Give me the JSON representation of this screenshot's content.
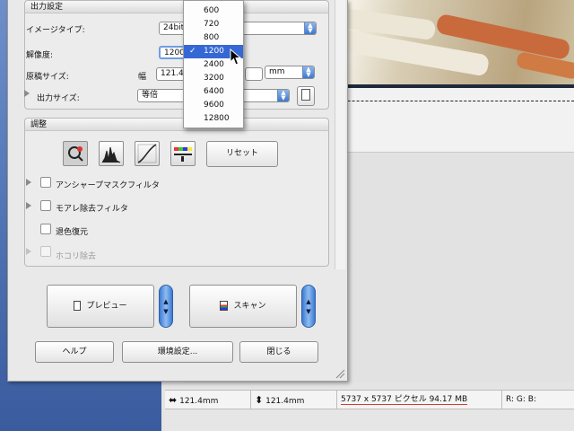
{
  "output_settings": {
    "title": "出力設定",
    "image_type_label": "イメージタイプ:",
    "image_type_value": "24bit",
    "resolution_label": "解像度:",
    "resolution_value": "1200",
    "size_label": "原稿サイズ:",
    "width_label": "幅",
    "width_value": "121.4",
    "unit_value": "mm",
    "output_size_label": "出力サイズ:",
    "output_size_value": "等倍"
  },
  "resolution_dropdown": {
    "options": [
      "600",
      "720",
      "800",
      "1200",
      "2400",
      "3200",
      "6400",
      "9600",
      "12800"
    ],
    "selected": "1200",
    "check_mark": "✓"
  },
  "adjust": {
    "title": "調整",
    "reset_label": "リセット",
    "tools": [
      "auto-adjust-icon",
      "histogram-icon",
      "tone-curve-icon",
      "color-balance-icon"
    ],
    "filters": [
      {
        "label": "アンシャープマスクフィルタ",
        "checked": false,
        "enabled": true
      },
      {
        "label": "モアレ除去フィルタ",
        "checked": false,
        "enabled": true
      },
      {
        "label": "退色復元",
        "checked": false,
        "enabled": true
      },
      {
        "label": "ホコリ除去",
        "checked": false,
        "enabled": false
      }
    ]
  },
  "actions": {
    "preview_label": "プレビュー",
    "scan_label": "スキャン",
    "help_label": "ヘルプ",
    "prefs_label": "環境設定...",
    "close_label": "閉じる"
  },
  "status": {
    "width": "121.4mm",
    "height": "121.4mm",
    "pixels": "5737 x 5737 ピクセル 94.17 MB",
    "rgb": "R: G: B:"
  },
  "colors": {
    "accent": "#3568d4",
    "warning_underline": "#d33b2c"
  }
}
